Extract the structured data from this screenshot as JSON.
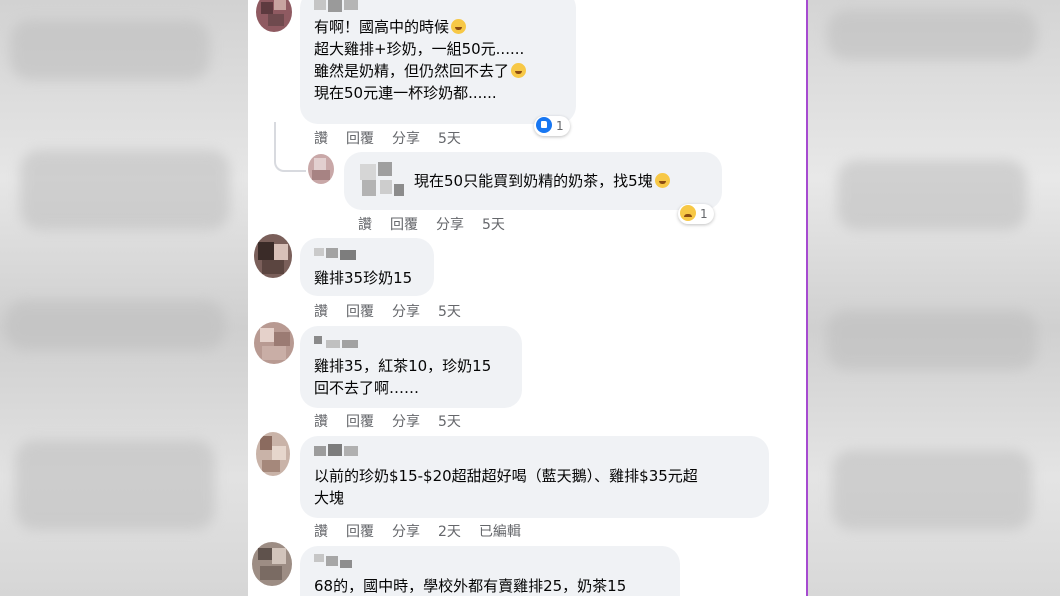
{
  "actions": {
    "like": "讚",
    "reply": "回覆",
    "share": "分享",
    "edited": "已編輯"
  },
  "comments": [
    {
      "lines": [
        "有啊！國高中的時候",
        "超大雞排+珍奶，一組50元......",
        "雖然是奶精，但仍然回不去了",
        "現在50元連一杯珍奶都......"
      ],
      "time": "5天",
      "reaction_count": "1",
      "reaction_icon": "like-icon"
    },
    {
      "lines": [
        "現在50只能買到奶精的奶茶，找5塊"
      ],
      "time": "5天",
      "reaction_count": "1",
      "reaction_icon": "sad-icon"
    },
    {
      "lines": [
        "雞排35珍奶15"
      ],
      "time": "5天"
    },
    {
      "lines": [
        "雞排35，紅茶10，珍奶15",
        "回不去了啊……"
      ],
      "time": "5天"
    },
    {
      "lines": [
        "以前的珍奶$15-$20超甜超好喝（藍天鵝）、雞排$35元超",
        "大塊"
      ],
      "time": "2天"
    },
    {
      "lines": [
        "68的，國中時，學校外都有賣雞排25，奶茶15"
      ]
    }
  ],
  "colors": {
    "bubble": "#f0f2f5",
    "meta": "#65676b",
    "like": "#1877f2",
    "border": "#a64ad0"
  }
}
